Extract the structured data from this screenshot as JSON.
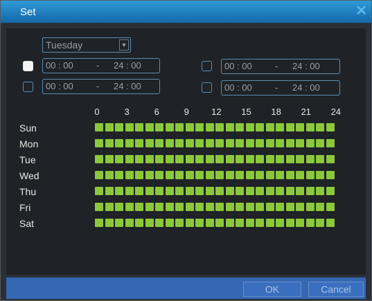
{
  "window": {
    "title": "Set"
  },
  "day_select": {
    "value": "Tuesday"
  },
  "periods": [
    {
      "enabled": true,
      "start": "00 : 00",
      "sep": "-",
      "end": "24 : 00"
    },
    {
      "enabled": false,
      "start": "00 : 00",
      "sep": "-",
      "end": "24 : 00"
    },
    {
      "enabled": false,
      "start": "00 : 00",
      "sep": "-",
      "end": "24 : 00"
    },
    {
      "enabled": false,
      "start": "00 : 00",
      "sep": "-",
      "end": "24 : 00"
    }
  ],
  "hour_labels": [
    "0",
    "3",
    "6",
    "9",
    "12",
    "15",
    "18",
    "21",
    "24"
  ],
  "days": [
    "Sun",
    "Mon",
    "Tue",
    "Wed",
    "Thu",
    "Fri",
    "Sat"
  ],
  "schedule_cells_per_day": 24,
  "schedule_active_color": "#8bc83a",
  "buttons": {
    "ok": "OK",
    "cancel": "Cancel"
  },
  "icons": {
    "close": "close-icon",
    "dropdown": "chevron-down-icon"
  }
}
